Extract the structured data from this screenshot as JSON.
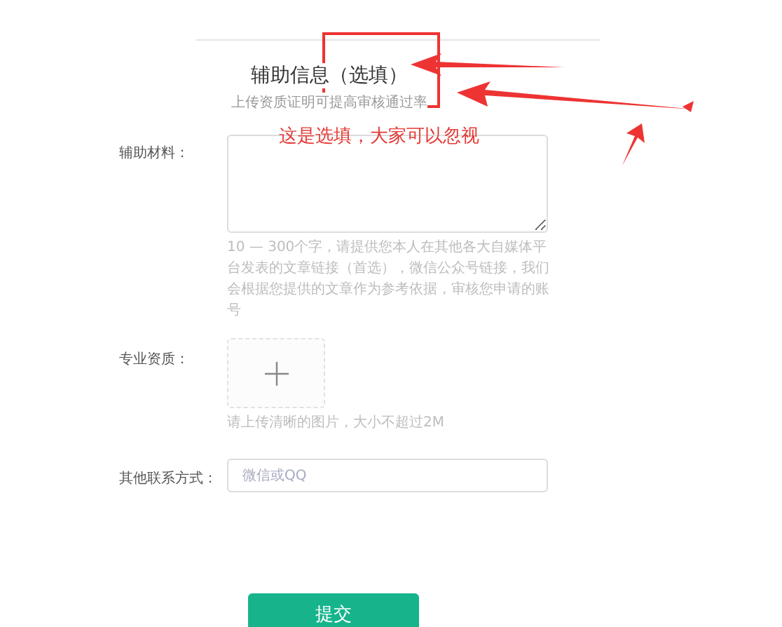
{
  "section": {
    "title": "辅助信息（选填）",
    "subtitle": "上传资质证明可提高审核通过率"
  },
  "fields": [
    {
      "kind": "textarea",
      "label": "辅助材料：",
      "hint": "10 — 300个字，请提供您本人在其他各大自媒体平台发表的文章链接（首选），微信公众号链接，我们会根据您提供的文章作为参考依据，审核您申请的账号"
    },
    {
      "kind": "upload",
      "label": "专业资质：",
      "hint": "请上传清晰的图片，大小不超过2M"
    },
    {
      "kind": "input",
      "label": "其他联系方式：",
      "placeholder": "微信或QQ"
    }
  ],
  "submit": "提交",
  "annotation": {
    "note": "这是选填，大家可以忽视"
  }
}
